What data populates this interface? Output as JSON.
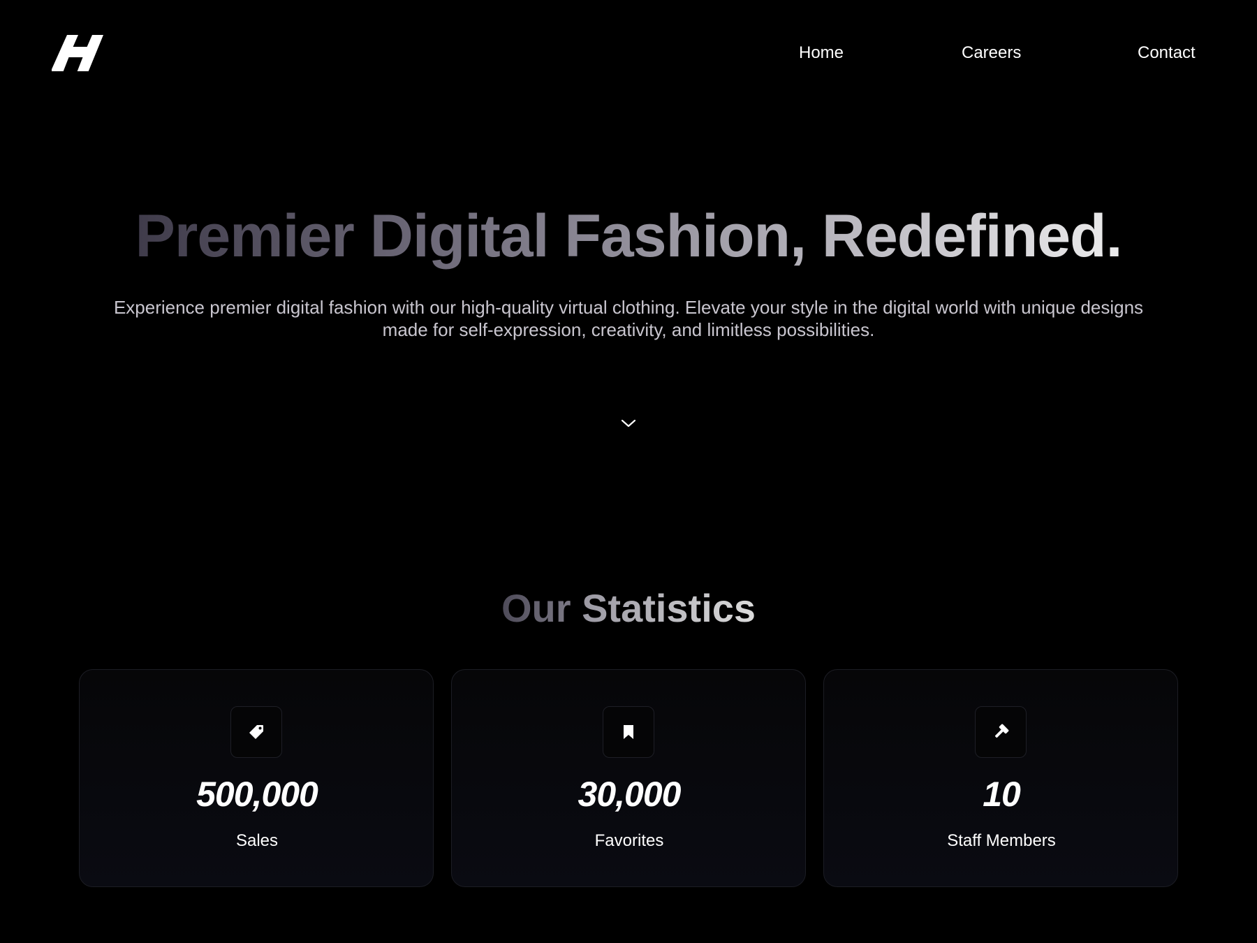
{
  "nav": {
    "logo_icon": "h-logo-icon",
    "items": [
      {
        "label": "Home"
      },
      {
        "label": "Careers"
      },
      {
        "label": "Contact"
      }
    ]
  },
  "hero": {
    "title": "Premier Digital Fashion, Redefined.",
    "subtitle": "Experience premier digital fashion with our high-quality virtual clothing. Elevate your style in the digital world with unique designs made for self-expression, creativity, and limitless possibilities.",
    "scroll_icon": "chevron-down-icon"
  },
  "stats": {
    "title_part1": "Our",
    "title_part2": "Statistics",
    "cards": [
      {
        "icon": "tag-icon",
        "value": "500,000",
        "label": "Sales"
      },
      {
        "icon": "bookmark-icon",
        "value": "30,000",
        "label": "Favorites"
      },
      {
        "icon": "hammer-icon",
        "value": "10",
        "label": "Staff Members"
      }
    ]
  },
  "colors": {
    "background": "#000000",
    "text": "#ffffff",
    "subtitle": "#c9c6cf",
    "card_border": "#1c1d24",
    "card_bg": "#0a0b12"
  }
}
